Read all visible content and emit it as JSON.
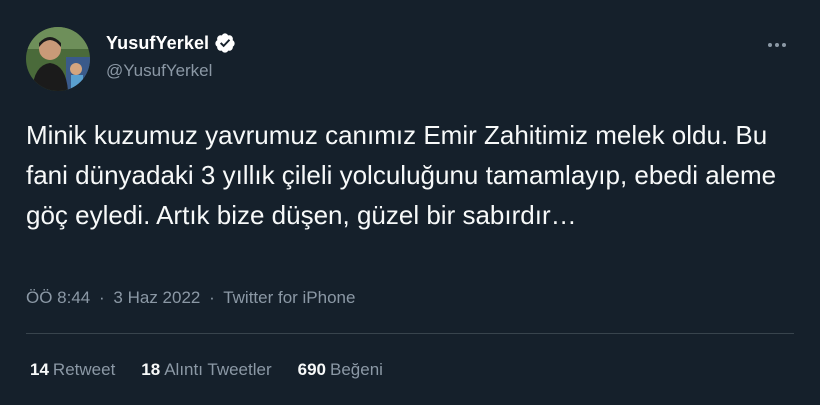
{
  "author": {
    "display_name": "YusufYerkel",
    "handle": "@YusufYerkel",
    "verified": true,
    "avatar_icon": "profile-photo-avatar",
    "verified_icon": "verified-badge-icon"
  },
  "tweet": {
    "text": "Minik kuzumuz yavrumuz canımız Emir Zahitimiz melek oldu. Bu fani dünyadaki 3 yıllık çileli yolculuğunu tamamlayıp, ebedi aleme göç eyledi. Artık bize düşen, güzel bir sabırdır…",
    "time": "ÖÖ 8:44",
    "separator": "·",
    "date": "3 Haz 2022",
    "source": "Twitter for iPhone"
  },
  "stats": {
    "retweets_count": "14",
    "retweets_label": "Retweet",
    "quotes_count": "18",
    "quotes_label": "Alıntı Tweetler",
    "likes_count": "690",
    "likes_label": "Beğeni"
  },
  "colors": {
    "background": "#15202b",
    "text_primary": "#f7f9f9",
    "text_secondary": "#8b98a5",
    "divider": "#38444d",
    "verified_badge": "#ffffff"
  },
  "icons": {
    "more": "more-horizontal-icon"
  }
}
